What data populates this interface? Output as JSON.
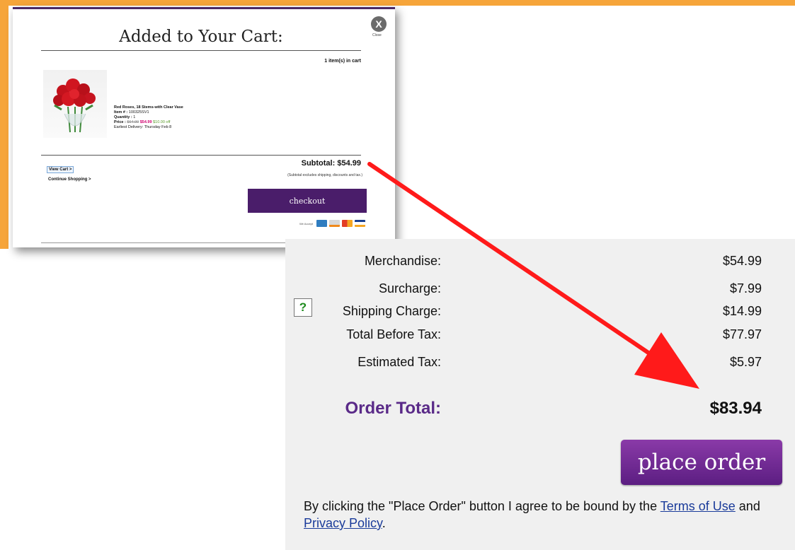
{
  "popup": {
    "close_symbol": "X",
    "close_label": "Close",
    "title": "Added to Your Cart:",
    "items_count": "1 item(s) in cart",
    "product": {
      "name": "Red Roses, 18 Stems-with Clear Vase",
      "item_label": "Item # :",
      "item_number": "100325SV1",
      "quantity_label": "Quantity :",
      "quantity": "1",
      "price_label": "Price :",
      "price_original": "$64.99",
      "price_sale": "$54.99",
      "price_off": "$10.00 off",
      "delivery": "Earliest Delivery: Thursday Feb 8"
    },
    "view_cart": "View Cart >",
    "continue_shopping": "Continue Shopping >",
    "subtotal_label": "Subtotal:",
    "subtotal_value": "$54.99",
    "subtotal_note": "(Subtotal excludes shipping, discounts and tax.)",
    "checkout": "checkout",
    "we_accept": "We Accept",
    "cards": [
      {
        "name": "amex-card-icon",
        "color": "#2f7dc0"
      },
      {
        "name": "discover-card-icon",
        "color": "#d9d9d9"
      },
      {
        "name": "mastercard-card-icon",
        "color": "#e33d25"
      },
      {
        "name": "visa-card-icon",
        "color": "#1a3f8f"
      }
    ]
  },
  "summary": {
    "merchandise_label": "Merchandise:",
    "merchandise_value": "$54.99",
    "surcharge_label": "Surcharge:",
    "surcharge_value": "$7.99",
    "help_symbol": "?",
    "shipping_label": "Shipping Charge:",
    "shipping_value": "$14.99",
    "total_before_tax_label": "Total Before Tax:",
    "total_before_tax_value": "$77.97",
    "estimated_tax_label": "Estimated Tax:",
    "estimated_tax_value": "$5.97",
    "order_total_label": "Order Total:",
    "order_total_value": "$83.94",
    "place_order": "place order",
    "agree_prefix": "By clicking the \"Place Order\" button I agree to be bound by the ",
    "terms_link": "Terms of Use",
    "agree_middle": " and ",
    "privacy_link": "Privacy Policy",
    "agree_suffix": "."
  },
  "colors": {
    "orange_frame": "#f6a53a",
    "purple_button": "#4a1d6a",
    "place_order_purple": "#7a2f9c",
    "order_total_label": "#5a2a88",
    "arrow_red": "#ff1a1a"
  }
}
